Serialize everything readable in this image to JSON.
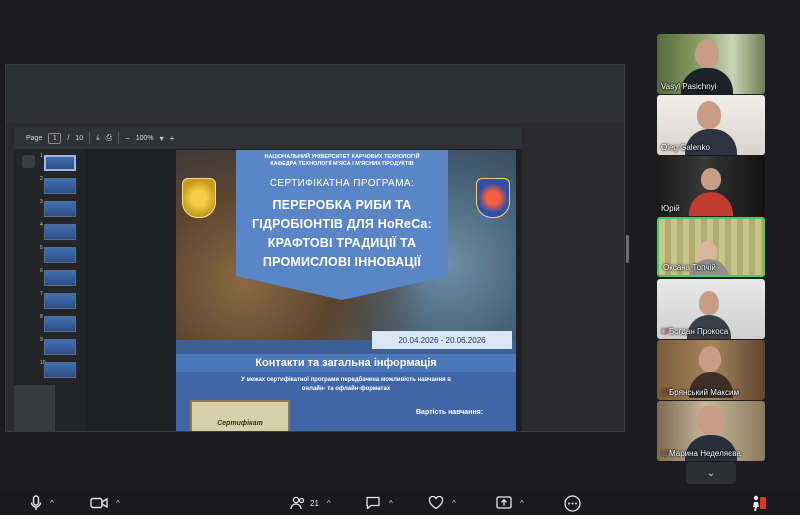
{
  "pdf_viewer": {
    "page_label": "Page",
    "current_page": "1",
    "page_sep": "/",
    "page_total": "10",
    "zoom": "100%",
    "zoom_minus": "−",
    "zoom_plus": "+",
    "thumbnails": [
      "1",
      "2",
      "3",
      "4",
      "5",
      "6",
      "7",
      "8",
      "9",
      "10"
    ]
  },
  "poster": {
    "university": "НАЦІОНАЛЬНИЙ УНІВЕРСИТЕТ ХАРЧОВИХ ТЕХНОЛОГІЙ",
    "department": "КАФЕДРА ТЕХНОЛОГІЇ М'ЯСА І М'ЯСНИХ ПРОДУКТІВ",
    "program": "СЕРТИФІКАТНА ПРОГРАМА:",
    "title_1": "ПЕРЕРОБКА РИБИ ТА",
    "title_2": "ГІДРОБІОНТІВ ДЛЯ HoReCa:",
    "title_3": "КРАФТОВІ ТРАДИЦІЇ ТА",
    "title_4": "ПРОМИСЛОВІ ІННОВАЦІЇ",
    "dates": "20.04.2026 - 20.06.2026",
    "contacts": "Контакти та загальна інформація",
    "note_1": "У межах сертифікатної програми передбачена можливість навчання в",
    "note_2": "онлайн- та офлайн-форматах",
    "certificate_word": "Сертифікат",
    "price_label": "Вартість навчання:"
  },
  "participants": [
    {
      "name": "Vasyl Pasichnyi",
      "muted": false
    },
    {
      "name": "Oleg Galenko",
      "muted": false
    },
    {
      "name": "Юрій",
      "muted": false
    },
    {
      "name": "Оксана Топчій",
      "muted": false,
      "speaking": true
    },
    {
      "name": "Богдан Прокоса",
      "muted": true
    },
    {
      "name": "Брянський Максим",
      "muted": true
    },
    {
      "name": "Марина Неделяєва",
      "muted": true
    }
  ],
  "toolbar": {
    "participants_count": "21",
    "caret": "^"
  },
  "colors": {
    "speaking_border": "#3fcf6a",
    "muted_icon": "#ff4d4d",
    "poster_blue": "#5a86c7"
  }
}
